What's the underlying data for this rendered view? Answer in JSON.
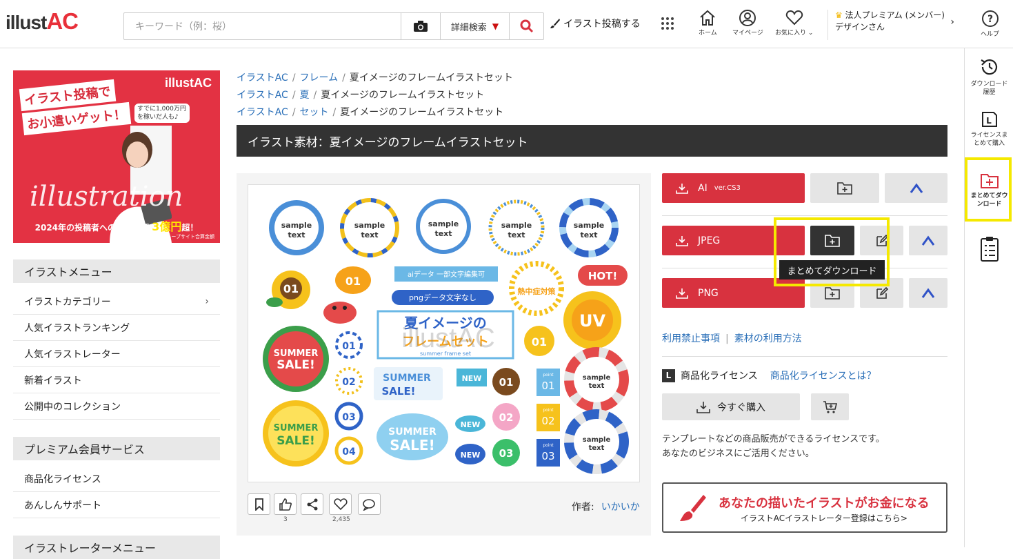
{
  "header": {
    "logo_text": "illust",
    "logo_ac": "AC",
    "search_placeholder": "キーワード（例：桜）",
    "detail_search": "詳細検索",
    "post_illust": "イラスト投稿する",
    "home": "ホーム",
    "mypage": "マイページ",
    "favorites": "お気に入り",
    "premium_line1": "法人プレミアム (メンバー)",
    "premium_line2": "デザインさん",
    "help": "ヘルプ"
  },
  "right_sidebar": {
    "download_history": "ダウンロード履歴",
    "license_bulk": "ライセンスまとめて購入",
    "bulk_download": "まとめてダウンロード"
  },
  "banner": {
    "line1": "イラスト投稿で",
    "line2": "お小遣いゲット！",
    "logo": "illustAC",
    "bubble": "すでに1,000万円を稼いだ人も♪",
    "word": "illustration",
    "caption_pre": "2024年の投稿者への支払総額",
    "caption_big": "3億円",
    "caption_post": "超！",
    "note": "※ACグループサイト合算金額"
  },
  "menu": {
    "illust_menu": "イラストメニュー",
    "items": [
      "イラストカテゴリー",
      "人気イラストランキング",
      "人気イラストレーター",
      "新着イラスト",
      "公開中のコレクション"
    ],
    "premium": "プレミアム会員サービス",
    "premium_items": [
      "商品化ライセンス",
      "あんしんサポート"
    ],
    "illustrator": "イラストレーターメニュー"
  },
  "breadcrumbs": [
    {
      "root": "イラストAC",
      "cat": "フレーム",
      "page": "夏イメージのフレームイラストセット"
    },
    {
      "root": "イラストAC",
      "cat": "夏",
      "page": "夏イメージのフレームイラストセット"
    },
    {
      "root": "イラストAC",
      "cat": "セット",
      "page": "夏イメージのフレームイラストセット"
    }
  ],
  "title": "イラスト素材：夏イメージのフレームイラストセット",
  "preview": {
    "sample": "sample",
    "text": "text",
    "ai_label": "aiデータ 一部文字編集可",
    "png_label": "pngデータ文字なし",
    "main1": "夏イメージの",
    "main2": "フレームセット",
    "main_sub": "summer frame set",
    "hot": "HOT!",
    "uv": "UV",
    "summer": "SUMMER",
    "sale": "SALE!",
    "new": "NEW",
    "heat": "熱中症対策",
    "nums": [
      "01",
      "02",
      "03",
      "04"
    ],
    "point": "point",
    "watermark": "illustAC"
  },
  "actions": {
    "like_count": "3",
    "fav_count": "2,435"
  },
  "author": {
    "label": "作者:",
    "name": "いかいか"
  },
  "downloads": {
    "ai": "AI",
    "ai_ver": "ver.CS3",
    "jpeg": "JPEG",
    "png": "PNG",
    "tooltip": "まとめてダウンロード"
  },
  "links": {
    "prohibited": "利用禁止事項",
    "usage": "素材の利用方法"
  },
  "license": {
    "badge": "L",
    "label": "商品化ライセンス",
    "what": "商品化ライセンスとは？",
    "buy_now": "今すぐ購入",
    "desc1": "テンプレートなどの商品販売ができるライセンスです。",
    "desc2": "あなたのビジネスにご活用ください。"
  },
  "promo": {
    "headline": "あなたの描いたイラストがお金になる",
    "sub": "イラストACイラストレーター登録はこちら>"
  },
  "colors": {
    "accent_red": "#d8323f",
    "link_blue": "#2a6fb8",
    "highlight_yellow": "#f5e900"
  }
}
